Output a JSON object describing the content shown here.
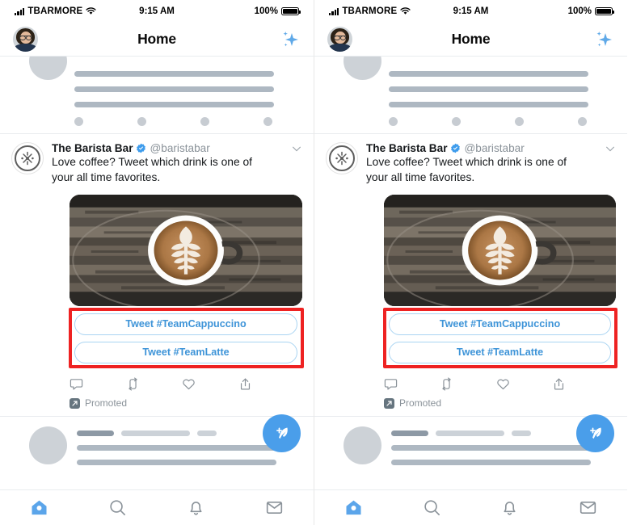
{
  "panels": [
    {
      "status_bar": {
        "carrier": "TBARMORE",
        "time": "9:15 AM",
        "battery": "100%"
      },
      "header": {
        "title": "Home",
        "avatar_icon": "user-avatar",
        "sparkle_icon": "sparkles-icon"
      },
      "tweet": {
        "display_name": "The Barista Bar",
        "verified_icon": "verified-badge-icon",
        "handle": "@baristabar",
        "chevron_icon": "chevron-down-icon",
        "text": "Love coffee? Tweet which drink is one of your all time favorites.",
        "media_alt": "latte-art-coffee-cup-on-wood",
        "cta_buttons": [
          {
            "label": "Tweet #TeamCappuccino"
          },
          {
            "label": "Tweet #TeamLatte"
          }
        ],
        "actions": [
          {
            "icon": "reply-icon"
          },
          {
            "icon": "retweet-icon"
          },
          {
            "icon": "like-icon"
          },
          {
            "icon": "share-icon"
          }
        ],
        "promoted_label": "Promoted",
        "promoted_icon": "promoted-arrow-icon"
      },
      "compose_button": {
        "icon": "compose-feather-icon"
      },
      "tab_bar": [
        {
          "icon": "home-icon",
          "active": true
        },
        {
          "icon": "search-icon",
          "active": false
        },
        {
          "icon": "notifications-bell-icon",
          "active": false
        },
        {
          "icon": "messages-envelope-icon",
          "active": false
        }
      ]
    },
    {
      "status_bar": {
        "carrier": "TBARMORE",
        "time": "9:15 AM",
        "battery": "100%"
      },
      "header": {
        "title": "Home",
        "avatar_icon": "user-avatar",
        "sparkle_icon": "sparkles-icon"
      },
      "tweet": {
        "display_name": "The Barista Bar",
        "verified_icon": "verified-badge-icon",
        "handle": "@baristabar",
        "chevron_icon": "chevron-down-icon",
        "text": "Love coffee? Tweet which drink is one of your all time favorites.",
        "media_alt": "latte-art-coffee-cup-on-wood",
        "cta_buttons": [
          {
            "label": "Tweet #TeamCappuccino"
          },
          {
            "label": "Tweet #TeamLatte"
          }
        ],
        "actions": [
          {
            "icon": "reply-icon"
          },
          {
            "icon": "retweet-icon"
          },
          {
            "icon": "like-icon"
          },
          {
            "icon": "share-icon"
          }
        ],
        "promoted_label": "Promoted",
        "promoted_icon": "promoted-arrow-icon"
      },
      "compose_button": {
        "icon": "compose-feather-icon"
      },
      "tab_bar": [
        {
          "icon": "home-icon",
          "active": true
        },
        {
          "icon": "search-icon",
          "active": false
        },
        {
          "icon": "notifications-bell-icon",
          "active": false
        },
        {
          "icon": "messages-envelope-icon",
          "active": false
        }
      ]
    }
  ],
  "annotation": {
    "highlight_color": "#ee2222",
    "target": "cta-buttons-group"
  },
  "colors": {
    "accent_blue": "#4a9eea",
    "cta_text": "#3e94d8",
    "cta_border": "#a9d4f2",
    "muted_gray": "#8a9299",
    "skeleton_gray": "#aeb8c2"
  }
}
